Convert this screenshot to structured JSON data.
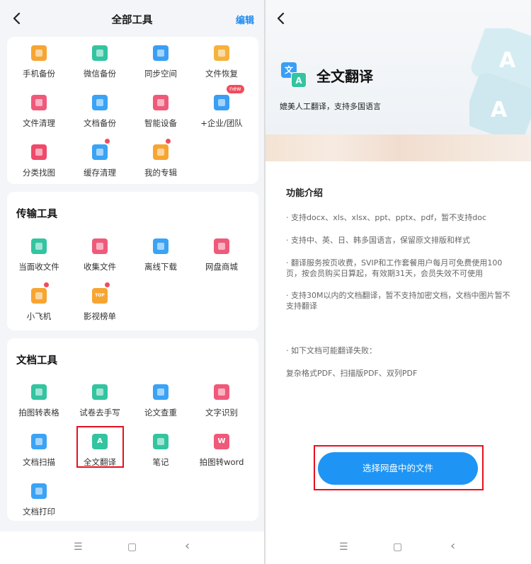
{
  "left": {
    "title": "全部工具",
    "edit_label": "编辑",
    "top_tools": [
      {
        "label": "手机备份",
        "icon": "phone-backup-icon",
        "color": "#f7a532"
      },
      {
        "label": "微信备份",
        "icon": "wechat-backup-icon",
        "color": "#33c4a0"
      },
      {
        "label": "同步空间",
        "icon": "sync-icon",
        "color": "#3a9ef5"
      },
      {
        "label": "文件恢复",
        "icon": "file-restore-icon",
        "color": "#f5b23c"
      },
      {
        "label": "文件清理",
        "icon": "file-clean-icon",
        "color": "#ef5a7a"
      },
      {
        "label": "文档备份",
        "icon": "doc-backup-icon",
        "color": "#3aa3f5"
      },
      {
        "label": "智能设备",
        "icon": "smart-device-icon",
        "color": "#ef5a7a"
      },
      {
        "label": "+企业/团队",
        "icon": "enterprise-icon",
        "color": "#3a9ef5",
        "badge": "new"
      },
      {
        "label": "分类找图",
        "icon": "find-image-icon",
        "color": "#ef4a6a"
      },
      {
        "label": "缓存清理",
        "icon": "cache-clean-icon",
        "color": "#3aa3f5",
        "dot": true
      },
      {
        "label": "我的专辑",
        "icon": "album-icon",
        "color": "#f7a532",
        "dot": true
      }
    ],
    "transfer": {
      "title": "传输工具",
      "tools": [
        {
          "label": "当面收文件",
          "icon": "receive-file-icon",
          "color": "#33c4a0"
        },
        {
          "label": "收集文件",
          "icon": "collect-file-icon",
          "color": "#ef5a7a"
        },
        {
          "label": "离线下载",
          "icon": "offline-download-icon",
          "color": "#3aa3f5"
        },
        {
          "label": "网盘商城",
          "icon": "store-icon",
          "color": "#ef5a7a"
        },
        {
          "label": "小飞机",
          "icon": "plane-icon",
          "color": "#f7a532",
          "dot": true
        },
        {
          "label": "影视榜单",
          "icon": "top-list-icon",
          "color": "#f7a532",
          "dot": true,
          "tag": "TOP"
        }
      ]
    },
    "docs": {
      "title": "文档工具",
      "tools": [
        {
          "label": "拍图转表格",
          "icon": "photo-to-table-icon",
          "color": "#33c4a0"
        },
        {
          "label": "试卷去手写",
          "icon": "remove-handwriting-icon",
          "color": "#33c4a0"
        },
        {
          "label": "论文查重",
          "icon": "paper-check-icon",
          "color": "#3aa3f5"
        },
        {
          "label": "文字识别",
          "icon": "ocr-icon",
          "color": "#ef5a7a"
        },
        {
          "label": "文档扫描",
          "icon": "doc-scan-icon",
          "color": "#3aa3f5"
        },
        {
          "label": "全文翻译",
          "icon": "translate-icon",
          "color": "#33c4a0",
          "tag": "A"
        },
        {
          "label": "笔记",
          "icon": "note-icon",
          "color": "#33c4a0"
        },
        {
          "label": "拍图转word",
          "icon": "photo-to-word-icon",
          "color": "#ef5a7a",
          "tag": "W"
        },
        {
          "label": "文档打印",
          "icon": "doc-print-icon",
          "color": "#3aa3f5"
        }
      ]
    }
  },
  "right": {
    "logo_glyph_1": "文",
    "logo_glyph_2": "A",
    "title": "全文翻译",
    "subtitle": "媲美人工翻译，支持多国语言",
    "section_title": "功能介绍",
    "features": [
      "· 支持docx、xls、xlsx、ppt、pptx、pdf，暂不支持doc",
      "· 支持中、英、日、韩多国语言，保留原文排版和样式",
      "· 翻译服务按页收费，SVIP和工作套餐用户每月可免费使用100页，按会员购买日算起，有效期31天，会员失效不可使用",
      "· 支持30M以内的文档翻译，暂不支持加密文档，文档中图片暂不支持翻译"
    ],
    "fail_note": "· 如下文档可能翻译失败：",
    "fail_types": "复杂格式PDF、扫描版PDF、双列PDF",
    "button_label": "选择网盘中的文件"
  },
  "nav": {
    "menu": "☰",
    "home": "▢",
    "back": "‹"
  },
  "colors": {
    "accent": "#1e8bf0",
    "button": "#1e95f5",
    "highlight": "#e5101e"
  }
}
